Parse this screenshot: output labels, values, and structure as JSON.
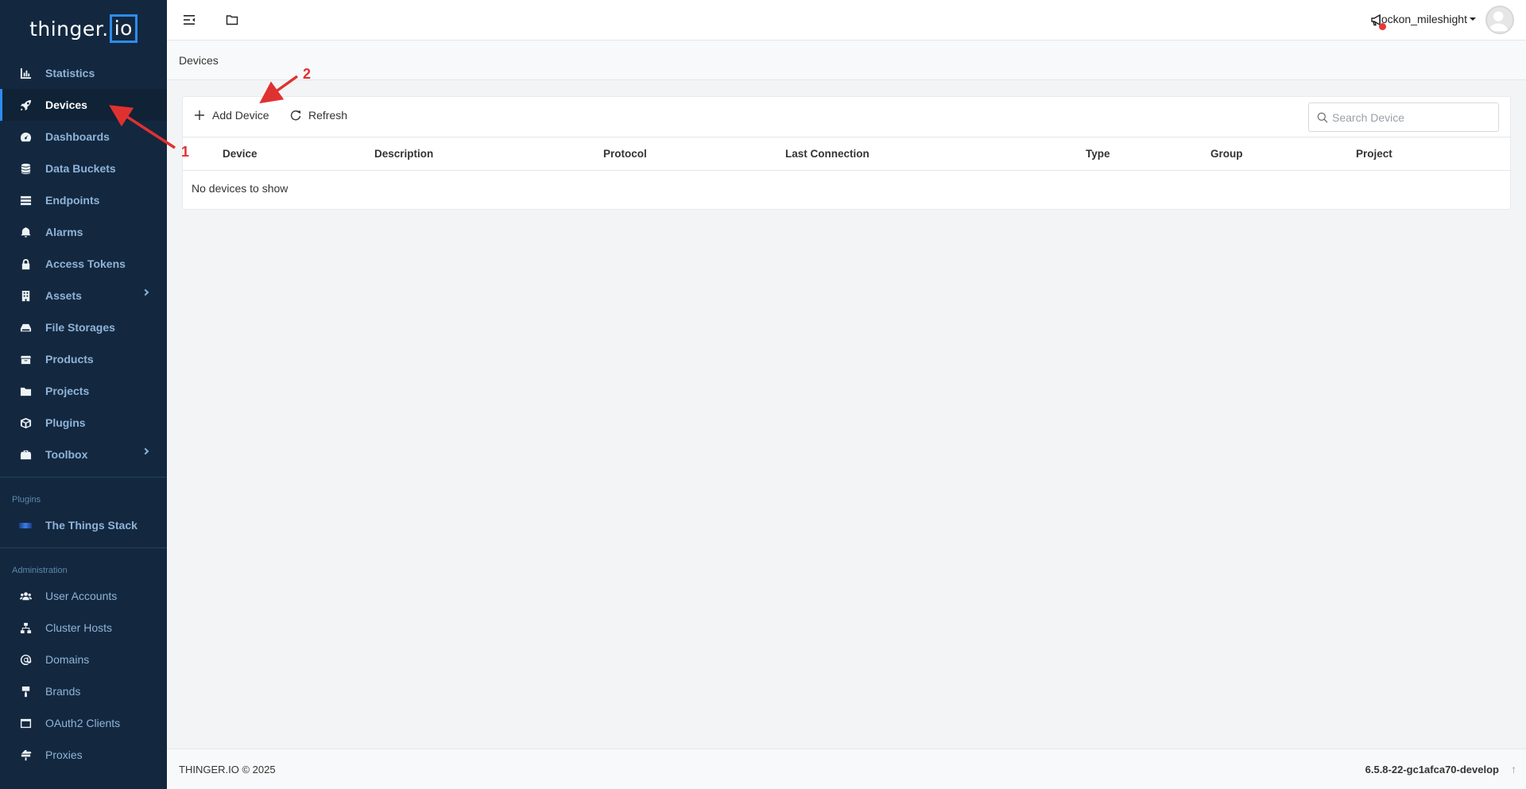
{
  "app": {
    "logo_text": "thinger.",
    "logo_boxed": "io"
  },
  "sidebar": {
    "items": [
      {
        "label": "Statistics",
        "icon": "chart-bar-icon"
      },
      {
        "label": "Devices",
        "icon": "rocket-icon",
        "active": true
      },
      {
        "label": "Dashboards",
        "icon": "gauge-icon"
      },
      {
        "label": "Data Buckets",
        "icon": "database-icon"
      },
      {
        "label": "Endpoints",
        "icon": "server-icon"
      },
      {
        "label": "Alarms",
        "icon": "bell-icon"
      },
      {
        "label": "Access Tokens",
        "icon": "lock-icon"
      },
      {
        "label": "Assets",
        "icon": "building-icon",
        "expandable": true
      },
      {
        "label": "File Storages",
        "icon": "hdd-icon"
      },
      {
        "label": "Products",
        "icon": "box-icon"
      },
      {
        "label": "Projects",
        "icon": "folder-icon"
      },
      {
        "label": "Plugins",
        "icon": "cube-icon"
      },
      {
        "label": "Toolbox",
        "icon": "toolbox-icon",
        "expandable": true
      }
    ],
    "plugins_section": "Plugins",
    "plugins": [
      {
        "label": "The Things Stack",
        "icon": "the-things-stack-icon"
      }
    ],
    "admin_section": "Administration",
    "admin_items": [
      {
        "label": "User Accounts",
        "icon": "users-icon"
      },
      {
        "label": "Cluster Hosts",
        "icon": "network-icon"
      },
      {
        "label": "Domains",
        "icon": "at-icon"
      },
      {
        "label": "Brands",
        "icon": "paint-roller-icon"
      },
      {
        "label": "OAuth2 Clients",
        "icon": "window-icon"
      },
      {
        "label": "Proxies",
        "icon": "signs-icon"
      }
    ]
  },
  "topbar": {
    "username": "lockon_mileshight"
  },
  "breadcrumb": {
    "current": "Devices"
  },
  "devices_card": {
    "add_label": "Add Device",
    "refresh_label": "Refresh",
    "search_placeholder": "Search Device",
    "columns": [
      "Device",
      "Description",
      "Protocol",
      "Last Connection",
      "Type",
      "Group",
      "Project"
    ],
    "empty_text": "No devices to show"
  },
  "footer": {
    "copyright": "THINGER.IO © 2025",
    "version": "6.5.8-22-gc1afca70-develop"
  },
  "annotations": {
    "step1": "1",
    "step2": "2",
    "color": "#e03131"
  }
}
